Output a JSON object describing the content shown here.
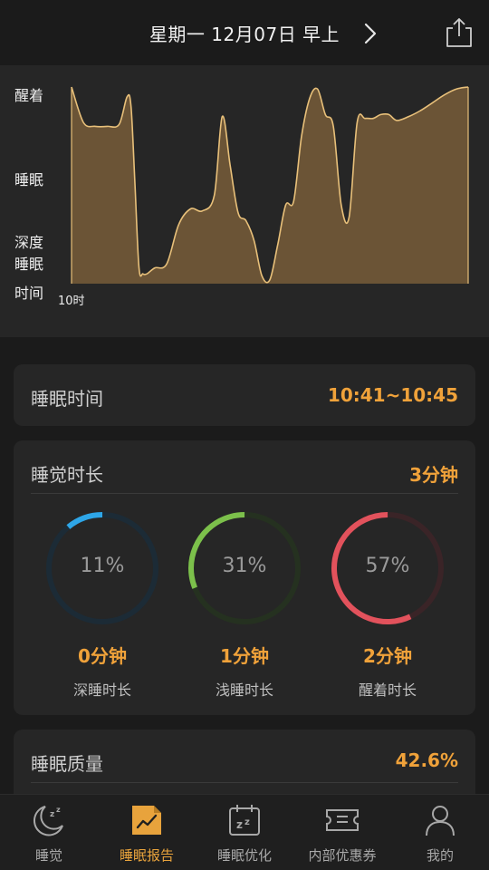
{
  "header": {
    "title": "星期一 12月07日 早上"
  },
  "chart": {
    "y_labels": [
      "醒着",
      "睡眠",
      "深度",
      "睡眠",
      "时间"
    ],
    "x_label": "10时"
  },
  "chart_data": {
    "type": "area",
    "title": "",
    "y_levels": [
      "醒着",
      "睡眠",
      "深度睡眠"
    ],
    "xlabel": "时间",
    "x_ticks": [
      "10时"
    ],
    "x_range": [
      0,
      100
    ],
    "y_range": [
      0,
      1
    ],
    "x": [
      0,
      3,
      6,
      9,
      12,
      14,
      15,
      16,
      17,
      18,
      19,
      21,
      24,
      27,
      30,
      33,
      36,
      38,
      40,
      42,
      44,
      46,
      48,
      50,
      52,
      54,
      56,
      58,
      60,
      62,
      64,
      66,
      68,
      70,
      72,
      74,
      76,
      78,
      80,
      82,
      85,
      88,
      91,
      94,
      97,
      100
    ],
    "y": [
      1.0,
      0.82,
      0.8,
      0.8,
      0.81,
      0.95,
      0.9,
      0.5,
      0.08,
      0.05,
      0.05,
      0.08,
      0.1,
      0.3,
      0.38,
      0.37,
      0.45,
      0.85,
      0.6,
      0.36,
      0.32,
      0.22,
      0.04,
      0.02,
      0.2,
      0.4,
      0.42,
      0.75,
      0.94,
      0.99,
      0.86,
      0.8,
      0.4,
      0.34,
      0.82,
      0.84,
      0.84,
      0.86,
      0.86,
      0.83,
      0.85,
      0.88,
      0.92,
      0.96,
      0.99,
      1.0
    ],
    "fill_color": "#6b5436",
    "line_color": "#e8c07a"
  },
  "sleep_time": {
    "title": "睡眠时间",
    "value": "10:41~10:45"
  },
  "duration": {
    "title": "睡觉时长",
    "value": "3分钟",
    "rings": [
      {
        "percent": 11,
        "percent_label": "11%",
        "minutes": "0分钟",
        "label": "深睡时长",
        "color": "#2ea6e8",
        "track": "#1c2b36"
      },
      {
        "percent": 31,
        "percent_label": "31%",
        "minutes": "1分钟",
        "label": "浅睡时长",
        "color": "#7cc04b",
        "track": "#253120"
      },
      {
        "percent": 57,
        "percent_label": "57%",
        "minutes": "2分钟",
        "label": "醒着时长",
        "color": "#e2525c",
        "track": "#3a2427"
      }
    ]
  },
  "quality": {
    "title": "睡眠质量",
    "value": "42.6%"
  },
  "tabs": [
    {
      "label": "睡觉",
      "icon": "moon-zz-icon",
      "active": false
    },
    {
      "label": "睡眠报告",
      "icon": "report-chart-icon",
      "active": true
    },
    {
      "label": "睡眠优化",
      "icon": "calendar-zz-icon",
      "active": false
    },
    {
      "label": "内部优惠券",
      "icon": "coupon-icon",
      "active": false
    },
    {
      "label": "我的",
      "icon": "person-icon",
      "active": false
    }
  ],
  "colors": {
    "accent": "#f0a23a",
    "background": "#1b1b1b",
    "card": "#262626"
  }
}
